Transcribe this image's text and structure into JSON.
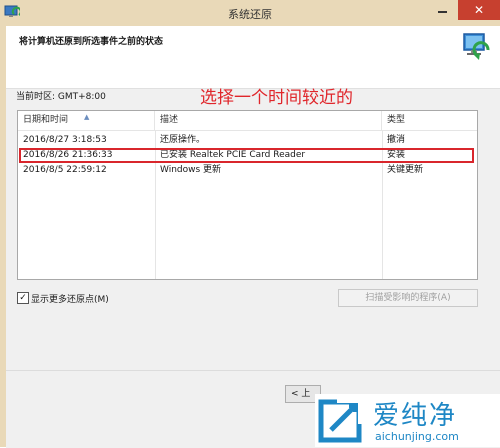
{
  "window": {
    "title": "系统还原",
    "close_glyph": "✕"
  },
  "header": {
    "title": "将计算机还原到所选事件之前的状态"
  },
  "timezone": {
    "label": "当前时区: GMT+8:00"
  },
  "annotation": {
    "text": "选择一个时间较近的",
    "color": "#e0262b"
  },
  "list": {
    "columns": {
      "date": "日期和时间",
      "description": "描述",
      "type": "类型"
    },
    "rows": [
      {
        "date": "2016/8/27 3:18:53",
        "description": "还原操作。",
        "type": "撤消"
      },
      {
        "date": "2016/8/26 21:36:33",
        "description": "已安装 Realtek PCIE Card Reader",
        "type": "安装"
      },
      {
        "date": "2016/8/5 22:59:12",
        "description": "Windows 更新",
        "type": "关键更新"
      }
    ],
    "highlighted_row": 1
  },
  "options": {
    "show_more_label": "显示更多还原点(M)",
    "show_more_checked": true,
    "check_glyph": "✓",
    "scan_button": "扫描受影响的程序(A)"
  },
  "footer": {
    "back_button": "< 上"
  },
  "watermark": {
    "brand_cn": "爱纯净",
    "domain": "aichunjing.com",
    "color": "#1e87c5"
  }
}
